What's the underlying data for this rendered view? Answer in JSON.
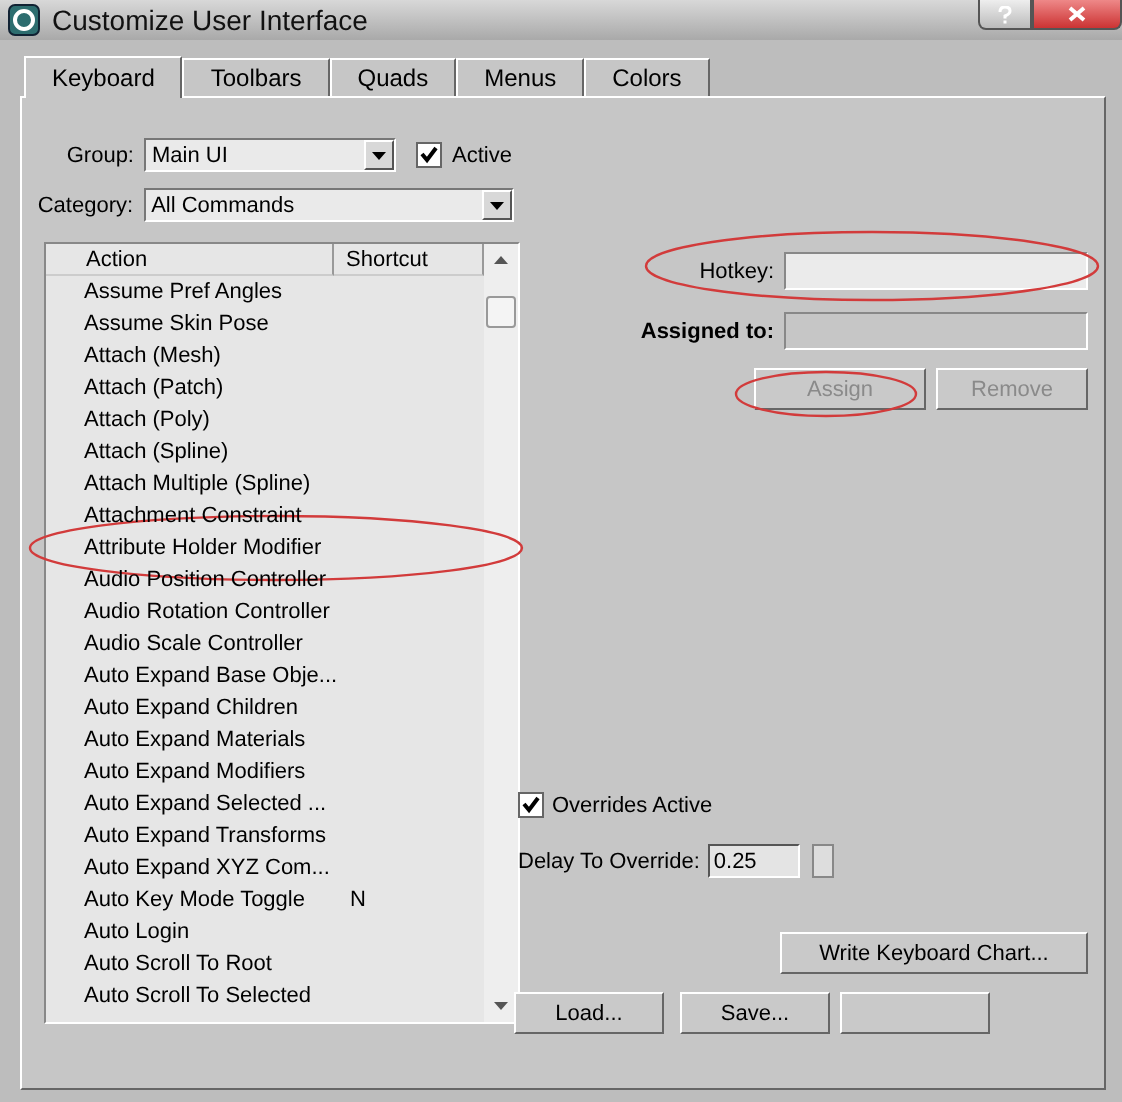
{
  "window": {
    "title": "Customize User Interface"
  },
  "tabs": [
    {
      "label": "Keyboard",
      "selected": true
    },
    {
      "label": "Toolbars",
      "selected": false
    },
    {
      "label": "Quads",
      "selected": false
    },
    {
      "label": "Menus",
      "selected": false
    },
    {
      "label": "Colors",
      "selected": false
    }
  ],
  "group": {
    "label": "Group:",
    "value": "Main UI"
  },
  "active": {
    "label": "Active",
    "checked": true
  },
  "category": {
    "label": "Category:",
    "value": "All Commands"
  },
  "action_list": {
    "columns": [
      "Action",
      "Shortcut"
    ],
    "rows": [
      {
        "action": "Assume Pref Angles"
      },
      {
        "action": "Assume Skin Pose"
      },
      {
        "action": "Attach (Mesh)"
      },
      {
        "action": "Attach (Patch)"
      },
      {
        "action": "Attach (Poly)"
      },
      {
        "action": "Attach (Spline)"
      },
      {
        "action": "Attach Multiple (Spline)"
      },
      {
        "action": "Attachment Constraint"
      },
      {
        "action": "Attribute Holder Modifier"
      },
      {
        "action": "Audio Position Controller"
      },
      {
        "action": "Audio Rotation Controller"
      },
      {
        "action": "Audio Scale Controller"
      },
      {
        "action": "Auto Expand Base Obje..."
      },
      {
        "action": "Auto Expand Children"
      },
      {
        "action": "Auto Expand Materials"
      },
      {
        "action": "Auto Expand Modifiers"
      },
      {
        "action": "Auto Expand Selected ..."
      },
      {
        "action": "Auto Expand Transforms"
      },
      {
        "action": "Auto Expand XYZ Com..."
      },
      {
        "action": "Auto Key Mode Toggle",
        "shortcut": "N"
      },
      {
        "action": "Auto Login"
      },
      {
        "action": "Auto Scroll To Root"
      },
      {
        "action": "Auto Scroll To Selected"
      }
    ]
  },
  "hotkey": {
    "label": "Hotkey:"
  },
  "assigned_to": {
    "label": "Assigned to:"
  },
  "assign_buttons": [
    {
      "label": "Assign",
      "disabled": true
    },
    {
      "label": "Remove",
      "disabled": true
    }
  ],
  "overrides_active": {
    "label": "Overrides Active",
    "checked": true
  },
  "delay": {
    "label": "Delay To Override:",
    "value": "0.25"
  },
  "write_chart_button": "Write Keyboard Chart...",
  "bottom_buttons": [
    {
      "label": "Load..."
    },
    {
      "label": "Save..."
    }
  ]
}
